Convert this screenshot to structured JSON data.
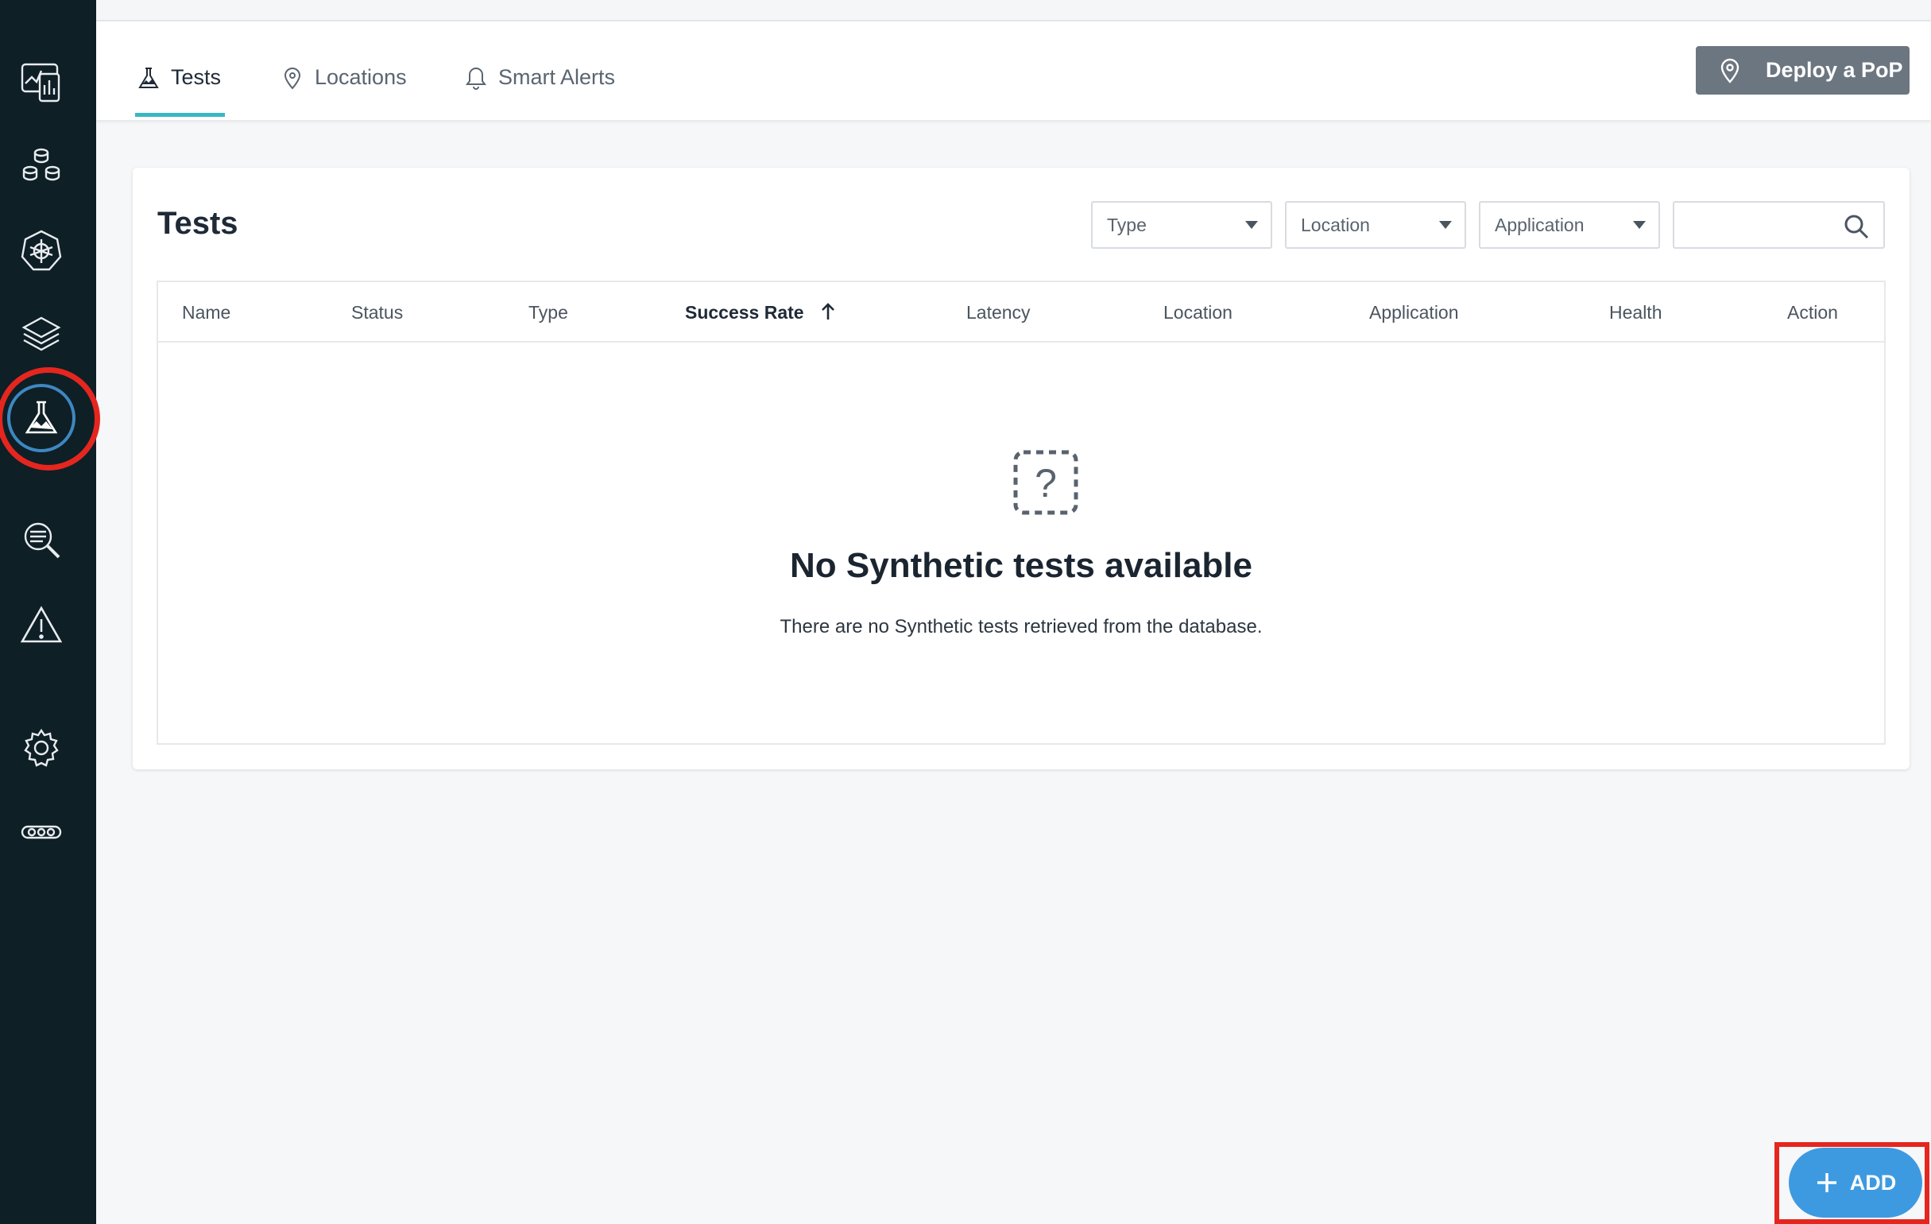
{
  "sidebar": {
    "items": [
      {
        "icon": "dashboard-icon"
      },
      {
        "icon": "infrastructure-icon"
      },
      {
        "icon": "kubernetes-icon"
      },
      {
        "icon": "layers-icon"
      },
      {
        "icon": "synthetic-flask-icon",
        "active": true
      },
      {
        "icon": "log-search-icon"
      },
      {
        "icon": "alert-triangle-icon"
      },
      {
        "icon": "settings-gear-icon"
      },
      {
        "icon": "more-integrations-icon"
      }
    ]
  },
  "tabs": [
    {
      "label": "Tests",
      "icon": "flask-icon",
      "active": true
    },
    {
      "label": "Locations",
      "icon": "location-pin-icon"
    },
    {
      "label": "Smart Alerts",
      "icon": "bell-icon"
    }
  ],
  "header": {
    "deploy_label": "Deploy a PoP"
  },
  "card": {
    "title": "Tests",
    "filters": {
      "type": "Type",
      "location": "Location",
      "application": "Application"
    },
    "search": {
      "value": "",
      "placeholder": ""
    }
  },
  "table": {
    "columns": [
      "Name",
      "Status",
      "Type",
      "Success Rate",
      "Latency",
      "Location",
      "Application",
      "Health",
      "Action"
    ],
    "sorted_column": "Success Rate",
    "sort_direction": "ascending"
  },
  "empty_state": {
    "icon": "question-mark-icon",
    "title": "No Synthetic tests available",
    "description": "There are no Synthetic tests retrieved from the database."
  },
  "fab": {
    "label": "ADD"
  },
  "colors": {
    "sidebar_bg": "#0e1f26",
    "accent_tab": "#3bb6c4",
    "active_ring": "#3e87c2",
    "add_button": "#3e9ae0",
    "deploy_button": "#6c7680",
    "annotation": "#e5261f"
  }
}
